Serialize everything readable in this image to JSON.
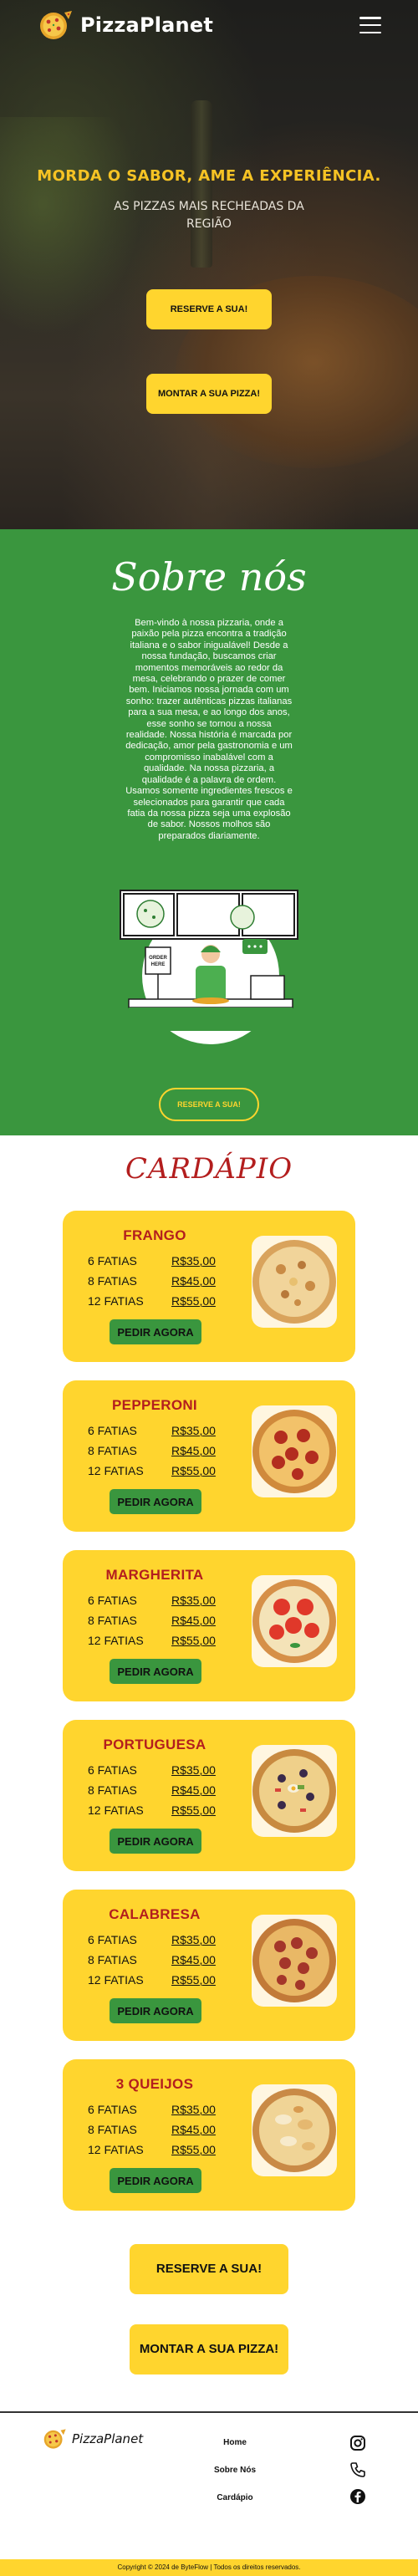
{
  "colors": {
    "accent_yellow": "#ffd52e",
    "green": "#3a963e",
    "red": "#b31e1e",
    "dark": "#111111"
  },
  "nav": {
    "brand": "PizzaPlanet",
    "logo_icon": "pizza-logo-icon",
    "menu_icon": "hamburger-menu-icon"
  },
  "hero": {
    "tagline": "MORDA O SABOR, AME A EXPERIÊNCIA.",
    "subtitle": "AS PIZZAS MAIS RECHEADAS DA REGIÃO",
    "reserve_label": "RESERVE A SUA!",
    "build_label": "MONTAR A SUA PIZZA!"
  },
  "about": {
    "title": "Sobre nós",
    "text": "Bem-vindo à nossa pizzaria, onde a paixão pela pizza encontra a tradição italiana e o sabor inigualável! Desde a nossa fundação, buscamos criar momentos memoráveis ao redor da mesa, celebrando o prazer de comer bem. Iniciamos nossa jornada com um sonho: trazer autênticas pizzas italianas para a sua mesa, e ao longo dos anos, esse sonho se tornou a nossa realidade. Nossa história é marcada por dedicação, amor pela gastronomia e um compromisso inabalável com a qualidade. Na nossa pizzaria, a qualidade é a palavra de ordem. Usamos somente ingredientes frescos e selecionados para garantir que cada fatia da nossa pizza seja uma explosão de sabor. Nossos molhos são preparados diariamente.",
    "illustration_sign": "ORDER HERE",
    "reserve_label": "RESERVE A SUA!"
  },
  "menu": {
    "title": "CARDÁPIO",
    "order_label": "PEDIR AGORA",
    "items": [
      {
        "name": "FRANGO",
        "prices": [
          {
            "size": "6 FATIAS",
            "price": "R$35,00"
          },
          {
            "size": "8 FATIAS",
            "price": "R$45,00"
          },
          {
            "size": "12 FATIAS",
            "price": "R$55,00"
          }
        ]
      },
      {
        "name": "PEPPERONI",
        "prices": [
          {
            "size": "6 FATIAS",
            "price": "R$35,00"
          },
          {
            "size": "8 FATIAS",
            "price": "R$45,00"
          },
          {
            "size": "12 FATIAS",
            "price": "R$55,00"
          }
        ]
      },
      {
        "name": "MARGHERITA",
        "prices": [
          {
            "size": "6 FATIAS",
            "price": "R$35,00"
          },
          {
            "size": "8 FATIAS",
            "price": "R$45,00"
          },
          {
            "size": "12 FATIAS",
            "price": "R$55,00"
          }
        ]
      },
      {
        "name": "PORTUGUESA",
        "prices": [
          {
            "size": "6 FATIAS",
            "price": "R$35,00"
          },
          {
            "size": "8 FATIAS",
            "price": "R$45,00"
          },
          {
            "size": "12 FATIAS",
            "price": "R$55,00"
          }
        ]
      },
      {
        "name": "CALABRESA",
        "prices": [
          {
            "size": "6 FATIAS",
            "price": "R$35,00"
          },
          {
            "size": "8 FATIAS",
            "price": "R$45,00"
          },
          {
            "size": "12 FATIAS",
            "price": "R$55,00"
          }
        ]
      },
      {
        "name": "3 QUEIJOS",
        "prices": [
          {
            "size": "6 FATIAS",
            "price": "R$35,00"
          },
          {
            "size": "8 FATIAS",
            "price": "R$45,00"
          },
          {
            "size": "12 FATIAS",
            "price": "R$55,00"
          }
        ]
      }
    ],
    "reserve_label": "RESERVE A SUA!",
    "build_label": "MONTAR A SUA PIZZA!"
  },
  "footer": {
    "brand": "PizzaPlanet",
    "links": [
      "Home",
      "Sobre Nós",
      "Cardápio"
    ],
    "icons": [
      "instagram-icon",
      "phone-icon",
      "facebook-icon"
    ],
    "copyright": "Copyright © 2024 de ByteFlow | Todos os direitos reservados."
  }
}
